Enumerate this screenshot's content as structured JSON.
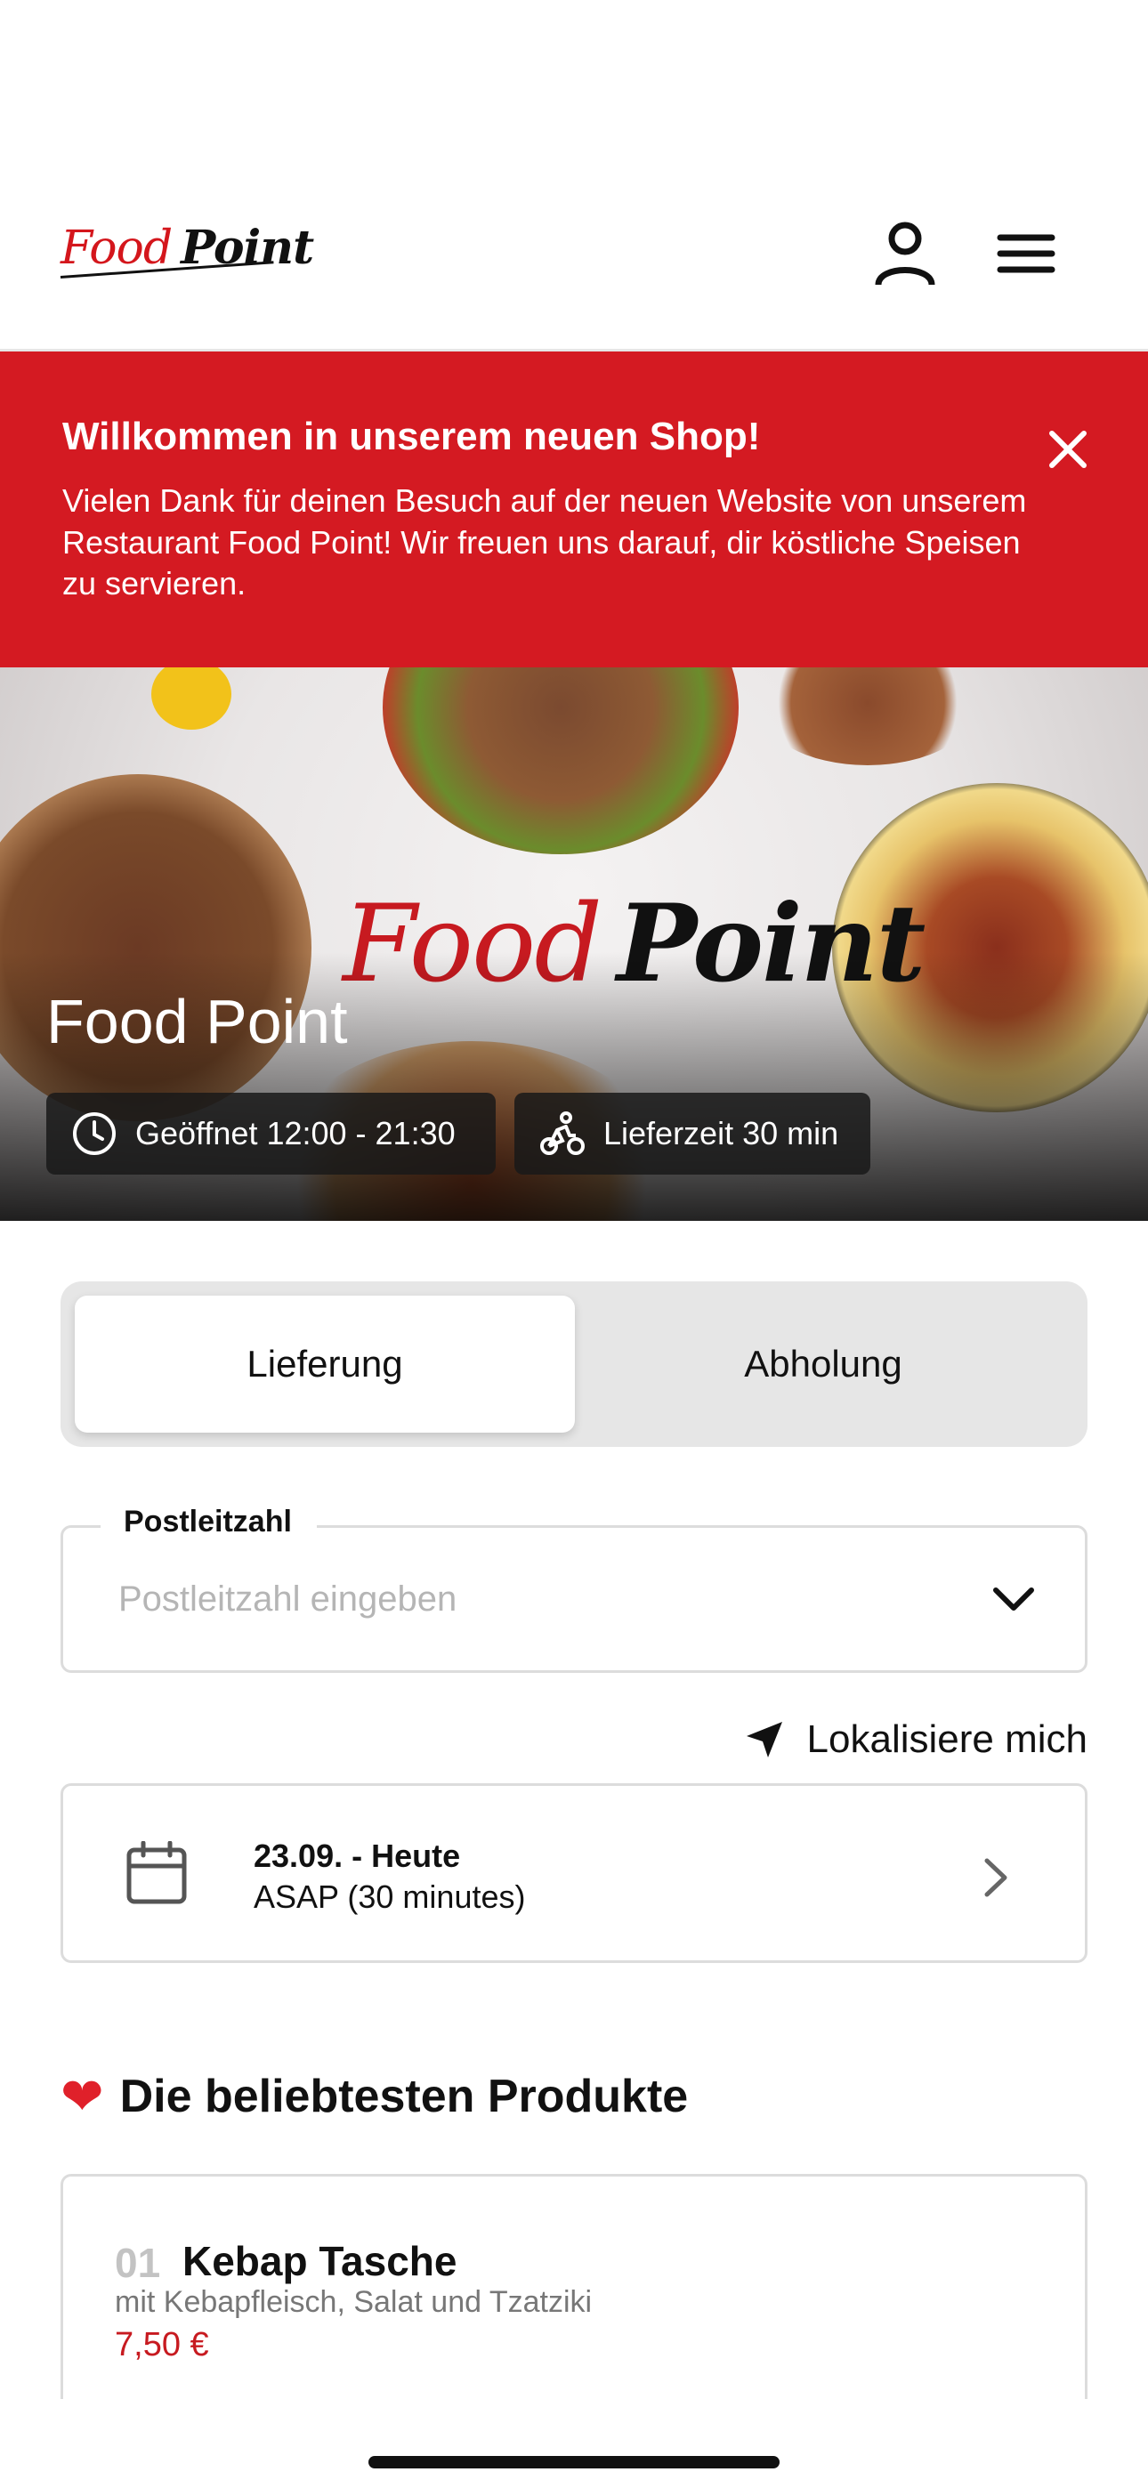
{
  "header": {
    "logo_food": "Food",
    "logo_point": "Point",
    "icons": [
      "user-icon",
      "hamburger-menu-icon"
    ]
  },
  "banner": {
    "title": "Willkommen in unserem neuen Shop!",
    "text": "Vielen Dank für deinen Besuch auf der neuen Website von unserem Restaurant Food Point! Wir freuen uns darauf, dir köstliche Speisen zu servieren.",
    "icon": "close-icon"
  },
  "hero": {
    "logo_food": "Food",
    "logo_point": "Point",
    "title": "Food Point",
    "opening": "Geöffnet 12:00 - 21:30",
    "delivery_time": "Lieferzeit 30 min",
    "colors": {
      "brand_red": "#d41a22"
    }
  },
  "order_mode": {
    "options": [
      "Lieferung",
      "Abholung"
    ],
    "selected": "Lieferung"
  },
  "postcode": {
    "label": "Postleitzahl",
    "placeholder": "Postleitzahl eingeben",
    "value": ""
  },
  "locate": {
    "label": "Lokalisiere mich"
  },
  "schedule": {
    "date": "23.09. - Heute",
    "time": "ASAP (30 minutes)"
  },
  "popular": {
    "heading": "Die beliebtesten Produkte",
    "items": [
      {
        "number": "01",
        "name": "Kebap Tasche",
        "description": "mit Kebapfleisch, Salat und Tzatziki",
        "price": "7,50 €"
      }
    ]
  }
}
